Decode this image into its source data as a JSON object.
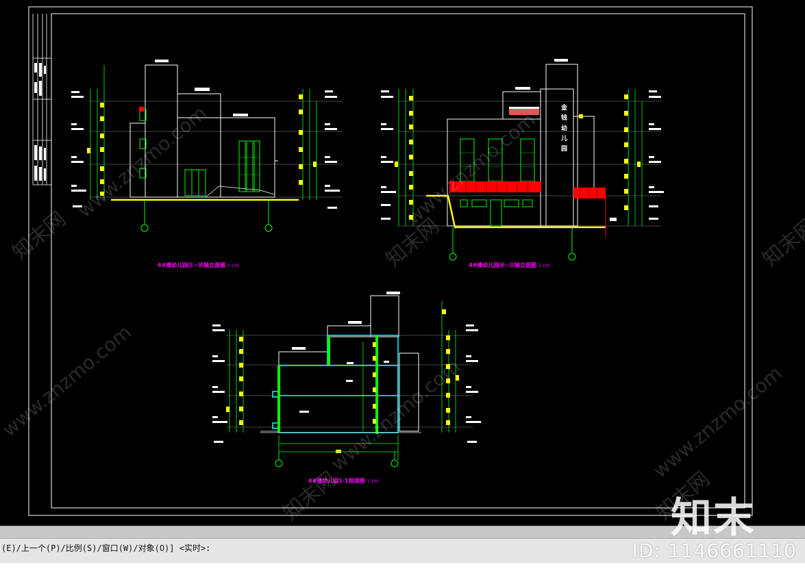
{
  "drawing": {
    "elevation_1_title": "4#楼幼儿园⑪~⑯轴立面图",
    "elevation_1_scale": "1:100",
    "elevation_2_title": "4#楼幼儿园⑯~⑪轴立面图",
    "elevation_2_scale": "1:100",
    "section_title": "4#楼幼儿园1-1剖面图",
    "section_scale": "1:100",
    "signage_text": "金钱幼儿园"
  },
  "command_line": {
    "prompt": "(E)/上一个(P)/比例(S)/窗口(W)/对象(O)] <实时>:"
  },
  "watermark": {
    "logo_text": "知末",
    "id_text": "ID: 1146661110",
    "site_text": "www.znzmo.com",
    "brand_text": "知末网"
  },
  "colors": {
    "background": "#000000",
    "frame": "#ffffff",
    "title": "#ff00ff",
    "dimension": "#00ff00",
    "level_marker": "#ffff00",
    "railing": "#ff0000",
    "section_cut": "#00ffff"
  }
}
